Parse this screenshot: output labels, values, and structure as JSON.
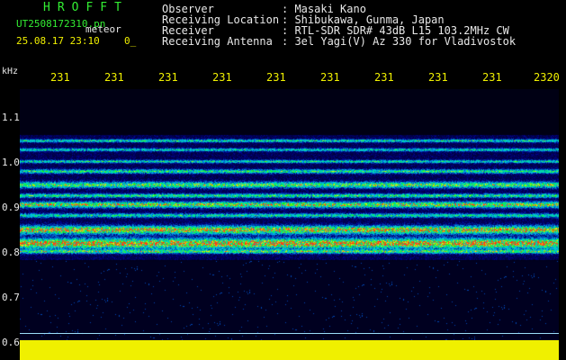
{
  "header": {
    "title": "HROFFT",
    "filename": "UT2508172310.pn",
    "tag": "meteor",
    "datetime": "25.08.17 23:10",
    "count": "0_",
    "info": [
      {
        "label": "Observer",
        "value": ": Masaki Kano"
      },
      {
        "label": "Receiving Location",
        "value": ": Shibukawa, Gunma, Japan"
      },
      {
        "label": "Receiver",
        "value": ": RTL-SDR SDR# 43dB L15 103.2MHz CW"
      },
      {
        "label": "Receiving Antenna",
        "value": ": 3el Yagi(V) Az 330 for Vladivostok"
      }
    ]
  },
  "axis": {
    "unit": "kHz",
    "time_ticks": [
      "231",
      "231",
      "231",
      "231",
      "231",
      "231",
      "231",
      "231",
      "231",
      "2320"
    ],
    "freq_ticks": [
      "1.1",
      "1.0",
      "0.9",
      "0.8",
      "0.7",
      "0.6"
    ]
  },
  "colors": {
    "label_green": "#33ee33",
    "text_white": "#e8e8e8",
    "trace_yellow": "#f0f000",
    "plot_background": "#000014"
  }
}
